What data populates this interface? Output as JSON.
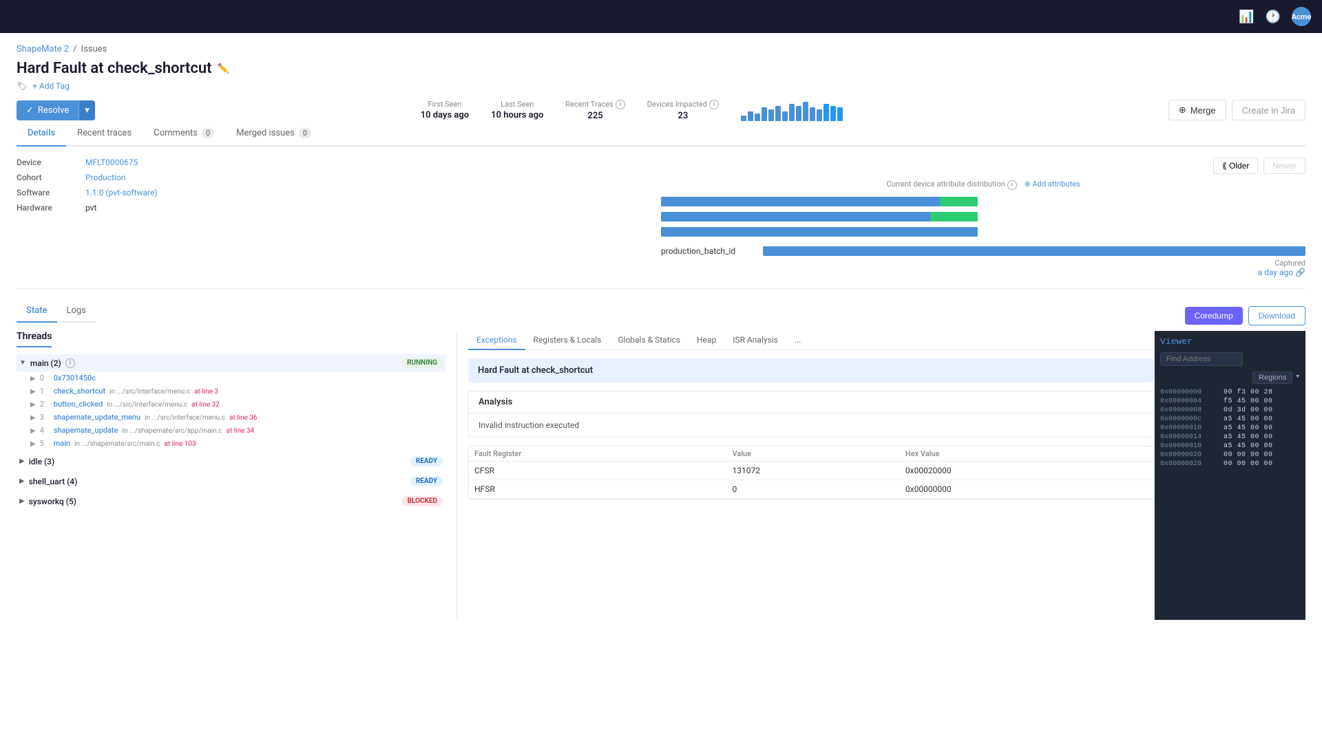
{
  "topnav": {
    "user": "Acme"
  },
  "breadcrumb": {
    "project": "ShapeMate 2",
    "separator": "/",
    "page": "Issues"
  },
  "page": {
    "title": "Hard Fault at check_shortcut",
    "add_tag_label": "+ Add Tag"
  },
  "actions": {
    "resolve_label": "Resolve",
    "merge_label": "Merge",
    "create_jira_label": "Create in Jira"
  },
  "stats": {
    "first_seen_label": "First Seen",
    "first_seen_value": "10 days ago",
    "last_seen_label": "Last Seen",
    "last_seen_value": "10 hours ago",
    "recent_traces_label": "Recent Traces",
    "recent_traces_value": "225",
    "devices_impacted_label": "Devices Impacted",
    "devices_impacted_value": "23"
  },
  "tabs": {
    "details": "Details",
    "recent_traces": "Recent traces",
    "comments": "Comments",
    "comments_count": "0",
    "merged_issues": "Merged issues",
    "merged_issues_count": "0"
  },
  "device_info": {
    "device_label": "Device",
    "device_value": "MFLT0000675",
    "cohort_label": "Cohort",
    "cohort_value": "Production",
    "software_label": "Software",
    "software_value": "1.1.0 (pvt-software)",
    "hardware_label": "Hardware",
    "hardware_value": "pvt"
  },
  "distribution": {
    "label": "Current device attribute distribution",
    "add_attributes_label": "Add attributes",
    "bars": [
      {
        "blue": 88,
        "green": 12
      },
      {
        "blue": 85,
        "green": 15
      },
      {
        "blue": 90,
        "green": 10
      }
    ],
    "batch_label": "production_batch_id"
  },
  "captured": {
    "label": "Captured",
    "value": "a day ago"
  },
  "nav_buttons": {
    "older": "Older",
    "newer": "Newer"
  },
  "state_tabs": {
    "state": "State",
    "logs": "Logs"
  },
  "top_right_trace_btns": {
    "coredump": "Coredump",
    "download": "Download"
  },
  "threads": {
    "title": "Threads",
    "items": [
      {
        "name": "main (2)",
        "status": "RUNNING",
        "status_class": "running",
        "expanded": true,
        "frames": [
          {
            "num": "0",
            "name": "0x7301450c",
            "location": "",
            "line": ""
          },
          {
            "num": "1",
            "name": "check_shortcut",
            "location": "in .../src/interface/menu.c",
            "line": "at line 3"
          },
          {
            "num": "2",
            "name": "button_clicked",
            "location": "in .../src/interface/menu.c",
            "line": "at line 32"
          },
          {
            "num": "3",
            "name": "shapemate_update_menu",
            "location": "in .../src/interface/menu.c",
            "line": "at line 36"
          },
          {
            "num": "4",
            "name": "shapemate_update",
            "location": "in .../shapemate/src/app/main.c",
            "line": "at line 34"
          },
          {
            "num": "5",
            "name": "main",
            "location": "in .../shapemate/src/main.c",
            "line": "at line 103"
          }
        ]
      },
      {
        "name": "idle (3)",
        "status": "READY",
        "status_class": "ready",
        "expanded": false,
        "frames": []
      },
      {
        "name": "shell_uart (4)",
        "status": "READY",
        "status_class": "ready",
        "expanded": false,
        "frames": []
      },
      {
        "name": "sysworkq (5)",
        "status": "BLOCKED",
        "status_class": "blocked",
        "expanded": false,
        "frames": []
      }
    ]
  },
  "analysis": {
    "tabs": [
      "Exceptions",
      "Registers & Locals",
      "Globals & Statics",
      "Heap",
      "ISR Analysis",
      "..."
    ],
    "active_tab": "Exceptions",
    "fault_title": "Hard Fault at check_shortcut",
    "analysis_label": "Analysis",
    "analysis_detail": "Invalid instruction executed",
    "fault_register_label": "Fault Register",
    "value_label": "Value",
    "hex_value_label": "Hex Value",
    "registers": [
      {
        "name": "CFSR",
        "value": "131072",
        "hex": "0x00020000"
      },
      {
        "name": "HFSR",
        "value": "0",
        "hex": "0x00000000"
      }
    ]
  },
  "viewer": {
    "title": "Viewer",
    "find_address_placeholder": "Find Address",
    "regions_label": "Regions",
    "memory": [
      {
        "addr": "0x00000000",
        "values": "90 f3 00 28"
      },
      {
        "addr": "0x00000004",
        "values": "f5 45 00 00"
      },
      {
        "addr": "0x00000008",
        "values": "0d 3d 00 00"
      },
      {
        "addr": "0x0000000c",
        "values": "a5 45 00 00"
      },
      {
        "addr": "0x00000010",
        "values": "a5 45 00 00"
      },
      {
        "addr": "0x00000014",
        "values": "a5 45 00 00"
      },
      {
        "addr": "0x00000018",
        "values": "a5 45 00 00"
      },
      {
        "addr": "0x00000020",
        "values": "00 00 00 00"
      },
      {
        "addr": "0x00000028",
        "values": "00 00 00 00"
      }
    ]
  },
  "sparkbars": [
    3,
    5,
    4,
    7,
    6,
    8,
    5,
    9,
    8,
    10,
    7,
    6,
    9,
    8,
    7
  ]
}
